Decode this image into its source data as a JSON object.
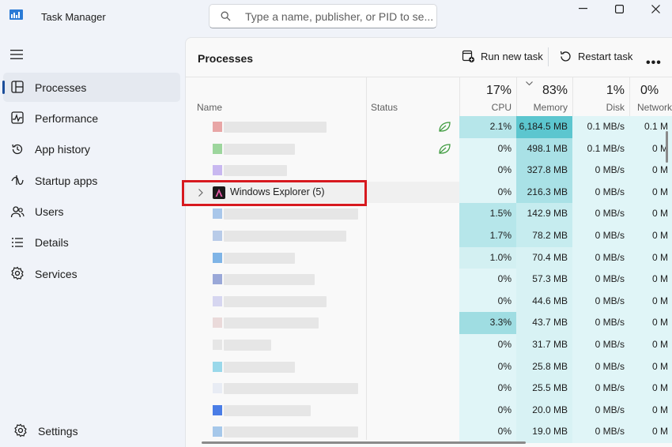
{
  "window": {
    "title": "Task Manager",
    "search_placeholder": "Type a name, publisher, or PID to se...",
    "controls": [
      "minimize",
      "maximize",
      "close"
    ]
  },
  "nav": {
    "items": [
      {
        "label": "Processes",
        "icon": "processes-icon",
        "active": true
      },
      {
        "label": "Performance",
        "icon": "performance-icon",
        "active": false
      },
      {
        "label": "App history",
        "icon": "app-history-icon",
        "active": false
      },
      {
        "label": "Startup apps",
        "icon": "startup-apps-icon",
        "active": false
      },
      {
        "label": "Users",
        "icon": "users-icon",
        "active": false
      },
      {
        "label": "Details",
        "icon": "details-icon",
        "active": false
      },
      {
        "label": "Services",
        "icon": "services-icon",
        "active": false
      }
    ],
    "settings_label": "Settings"
  },
  "toolbar": {
    "title": "Processes",
    "run_new_task": "Run new task",
    "restart_task": "Restart task",
    "more": "•••"
  },
  "columns": {
    "name": "Name",
    "status": "Status",
    "cpu": {
      "pct": "17%",
      "label": "CPU"
    },
    "memory": {
      "pct": "83%",
      "label": "Memory"
    },
    "disk": {
      "pct": "1%",
      "label": "Disk"
    },
    "network": {
      "pct": "0%",
      "label": "Network"
    }
  },
  "processes": [
    {
      "name": "",
      "cpu": "2.1%",
      "memory": "6,184.5 MB",
      "disk": "0.1 MB/s",
      "network": "0.1 M",
      "eco": true
    },
    {
      "name": "",
      "cpu": "0%",
      "memory": "498.1 MB",
      "disk": "0.1 MB/s",
      "network": "0 M",
      "eco": true
    },
    {
      "name": "",
      "cpu": "0%",
      "memory": "327.8 MB",
      "disk": "0 MB/s",
      "network": "0 M",
      "eco": false
    },
    {
      "name": "Windows Explorer (5)",
      "cpu": "0%",
      "memory": "216.3 MB",
      "disk": "0 MB/s",
      "network": "0 M",
      "eco": false
    },
    {
      "name": "",
      "cpu": "1.5%",
      "memory": "142.9 MB",
      "disk": "0 MB/s",
      "network": "0 M",
      "eco": false
    },
    {
      "name": "",
      "cpu": "1.7%",
      "memory": "78.2 MB",
      "disk": "0 MB/s",
      "network": "0 M",
      "eco": false
    },
    {
      "name": "",
      "cpu": "1.0%",
      "memory": "70.4 MB",
      "disk": "0 MB/s",
      "network": "0 M",
      "eco": false
    },
    {
      "name": "",
      "cpu": "0%",
      "memory": "57.3 MB",
      "disk": "0 MB/s",
      "network": "0 M",
      "eco": false
    },
    {
      "name": "",
      "cpu": "0%",
      "memory": "44.6 MB",
      "disk": "0 MB/s",
      "network": "0 M",
      "eco": false
    },
    {
      "name": "",
      "cpu": "3.3%",
      "memory": "43.7 MB",
      "disk": "0 MB/s",
      "network": "0 M",
      "eco": false
    },
    {
      "name": "",
      "cpu": "0%",
      "memory": "31.7 MB",
      "disk": "0 MB/s",
      "network": "0 M",
      "eco": false
    },
    {
      "name": "",
      "cpu": "0%",
      "memory": "25.8 MB",
      "disk": "0 MB/s",
      "network": "0 M",
      "eco": false
    },
    {
      "name": "",
      "cpu": "0%",
      "memory": "25.5 MB",
      "disk": "0 MB/s",
      "network": "0 M",
      "eco": false
    },
    {
      "name": "",
      "cpu": "0%",
      "memory": "20.0 MB",
      "disk": "0 MB/s",
      "network": "0 M",
      "eco": false
    },
    {
      "name": "",
      "cpu": "0%",
      "memory": "19.0 MB",
      "disk": "0 MB/s",
      "network": "0 M",
      "eco": false
    }
  ],
  "colors": {
    "accent": "#1c4e9a",
    "highlight_box": "#d7191f",
    "heat_strong": "#9fdde2",
    "heat_medium": "#c6ecef",
    "heat_light": "#e0f5f7",
    "memory_top": "#5cc6cf"
  }
}
